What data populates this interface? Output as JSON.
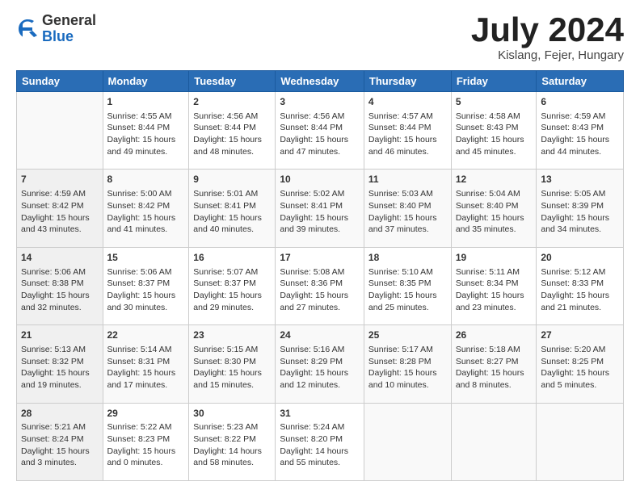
{
  "logo": {
    "general": "General",
    "blue": "Blue"
  },
  "title": "July 2024",
  "subtitle": "Kislang, Fejer, Hungary",
  "days": [
    "Sunday",
    "Monday",
    "Tuesday",
    "Wednesday",
    "Thursday",
    "Friday",
    "Saturday"
  ],
  "weeks": [
    [
      {
        "num": "",
        "info": ""
      },
      {
        "num": "1",
        "info": "Sunrise: 4:55 AM\nSunset: 8:44 PM\nDaylight: 15 hours\nand 49 minutes."
      },
      {
        "num": "2",
        "info": "Sunrise: 4:56 AM\nSunset: 8:44 PM\nDaylight: 15 hours\nand 48 minutes."
      },
      {
        "num": "3",
        "info": "Sunrise: 4:56 AM\nSunset: 8:44 PM\nDaylight: 15 hours\nand 47 minutes."
      },
      {
        "num": "4",
        "info": "Sunrise: 4:57 AM\nSunset: 8:44 PM\nDaylight: 15 hours\nand 46 minutes."
      },
      {
        "num": "5",
        "info": "Sunrise: 4:58 AM\nSunset: 8:43 PM\nDaylight: 15 hours\nand 45 minutes."
      },
      {
        "num": "6",
        "info": "Sunrise: 4:59 AM\nSunset: 8:43 PM\nDaylight: 15 hours\nand 44 minutes."
      }
    ],
    [
      {
        "num": "7",
        "info": "Sunrise: 4:59 AM\nSunset: 8:42 PM\nDaylight: 15 hours\nand 43 minutes."
      },
      {
        "num": "8",
        "info": "Sunrise: 5:00 AM\nSunset: 8:42 PM\nDaylight: 15 hours\nand 41 minutes."
      },
      {
        "num": "9",
        "info": "Sunrise: 5:01 AM\nSunset: 8:41 PM\nDaylight: 15 hours\nand 40 minutes."
      },
      {
        "num": "10",
        "info": "Sunrise: 5:02 AM\nSunset: 8:41 PM\nDaylight: 15 hours\nand 39 minutes."
      },
      {
        "num": "11",
        "info": "Sunrise: 5:03 AM\nSunset: 8:40 PM\nDaylight: 15 hours\nand 37 minutes."
      },
      {
        "num": "12",
        "info": "Sunrise: 5:04 AM\nSunset: 8:40 PM\nDaylight: 15 hours\nand 35 minutes."
      },
      {
        "num": "13",
        "info": "Sunrise: 5:05 AM\nSunset: 8:39 PM\nDaylight: 15 hours\nand 34 minutes."
      }
    ],
    [
      {
        "num": "14",
        "info": "Sunrise: 5:06 AM\nSunset: 8:38 PM\nDaylight: 15 hours\nand 32 minutes."
      },
      {
        "num": "15",
        "info": "Sunrise: 5:06 AM\nSunset: 8:37 PM\nDaylight: 15 hours\nand 30 minutes."
      },
      {
        "num": "16",
        "info": "Sunrise: 5:07 AM\nSunset: 8:37 PM\nDaylight: 15 hours\nand 29 minutes."
      },
      {
        "num": "17",
        "info": "Sunrise: 5:08 AM\nSunset: 8:36 PM\nDaylight: 15 hours\nand 27 minutes."
      },
      {
        "num": "18",
        "info": "Sunrise: 5:10 AM\nSunset: 8:35 PM\nDaylight: 15 hours\nand 25 minutes."
      },
      {
        "num": "19",
        "info": "Sunrise: 5:11 AM\nSunset: 8:34 PM\nDaylight: 15 hours\nand 23 minutes."
      },
      {
        "num": "20",
        "info": "Sunrise: 5:12 AM\nSunset: 8:33 PM\nDaylight: 15 hours\nand 21 minutes."
      }
    ],
    [
      {
        "num": "21",
        "info": "Sunrise: 5:13 AM\nSunset: 8:32 PM\nDaylight: 15 hours\nand 19 minutes."
      },
      {
        "num": "22",
        "info": "Sunrise: 5:14 AM\nSunset: 8:31 PM\nDaylight: 15 hours\nand 17 minutes."
      },
      {
        "num": "23",
        "info": "Sunrise: 5:15 AM\nSunset: 8:30 PM\nDaylight: 15 hours\nand 15 minutes."
      },
      {
        "num": "24",
        "info": "Sunrise: 5:16 AM\nSunset: 8:29 PM\nDaylight: 15 hours\nand 12 minutes."
      },
      {
        "num": "25",
        "info": "Sunrise: 5:17 AM\nSunset: 8:28 PM\nDaylight: 15 hours\nand 10 minutes."
      },
      {
        "num": "26",
        "info": "Sunrise: 5:18 AM\nSunset: 8:27 PM\nDaylight: 15 hours\nand 8 minutes."
      },
      {
        "num": "27",
        "info": "Sunrise: 5:20 AM\nSunset: 8:25 PM\nDaylight: 15 hours\nand 5 minutes."
      }
    ],
    [
      {
        "num": "28",
        "info": "Sunrise: 5:21 AM\nSunset: 8:24 PM\nDaylight: 15 hours\nand 3 minutes."
      },
      {
        "num": "29",
        "info": "Sunrise: 5:22 AM\nSunset: 8:23 PM\nDaylight: 15 hours\nand 0 minutes."
      },
      {
        "num": "30",
        "info": "Sunrise: 5:23 AM\nSunset: 8:22 PM\nDaylight: 14 hours\nand 58 minutes."
      },
      {
        "num": "31",
        "info": "Sunrise: 5:24 AM\nSunset: 8:20 PM\nDaylight: 14 hours\nand 55 minutes."
      },
      {
        "num": "",
        "info": ""
      },
      {
        "num": "",
        "info": ""
      },
      {
        "num": "",
        "info": ""
      }
    ]
  ]
}
